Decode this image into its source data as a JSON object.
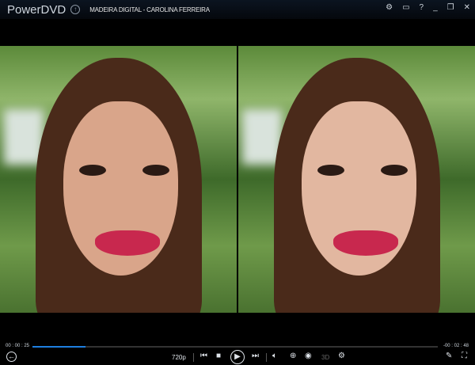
{
  "app": {
    "name": "PowerDVD",
    "title": "MADEIRA DIGITAL - CAROLINA FERREIRA"
  },
  "window_controls": [
    "settings-icon",
    "tv-mode-icon",
    "help",
    "minimize",
    "restore",
    "close"
  ],
  "playback": {
    "elapsed": "00 : 00 : 25",
    "remaining": "-00 : 02 : 48",
    "progress_fraction": 0.13,
    "resolution": "720p",
    "mode_3d": "3D",
    "accent": "#1e7fe0"
  }
}
